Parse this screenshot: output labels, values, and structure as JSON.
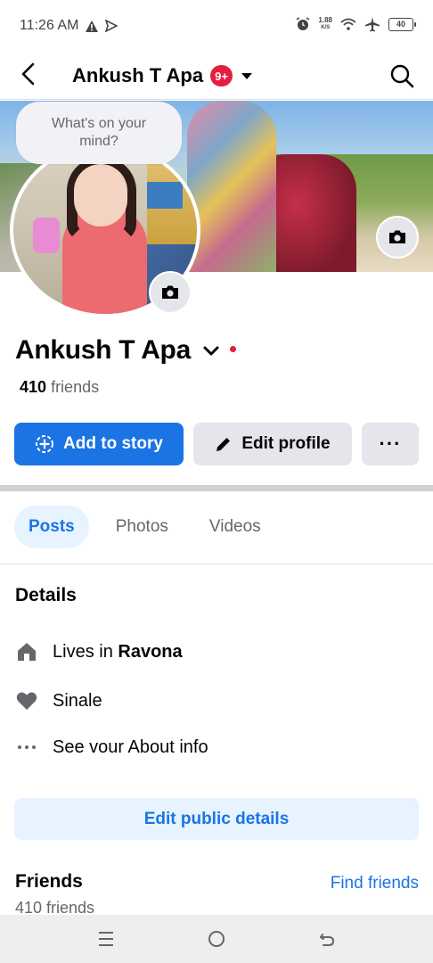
{
  "status_bar": {
    "time": "11:26 AM",
    "net_speed_value": "1.88",
    "net_speed_unit": "K/S",
    "battery": "40"
  },
  "header": {
    "title": "Ankush T Apa",
    "badge": "9+"
  },
  "composer": {
    "prompt": "What's on your mind?"
  },
  "profile": {
    "name": "Ankush T Apa",
    "friends_count": "410",
    "friends_label": "friends"
  },
  "actions": {
    "add_story": "Add to story",
    "edit_profile": "Edit profile",
    "more": "···"
  },
  "tabs": [
    {
      "label": "Posts",
      "active": true
    },
    {
      "label": "Photos",
      "active": false
    },
    {
      "label": "Videos",
      "active": false
    }
  ],
  "details": {
    "title": "Details",
    "lives_prefix": "Lives in ",
    "lives_place": "Ravona",
    "relationship": "Sinale",
    "about_link": "See vour About info",
    "edit_public": "Edit public details"
  },
  "friends_section": {
    "title": "Friends",
    "find_friends": "Find friends",
    "subtitle": "410 friends"
  },
  "colors": {
    "accent": "#1b74e4",
    "badge": "#e41e3f",
    "tab_active_bg": "#e7f3ff"
  }
}
